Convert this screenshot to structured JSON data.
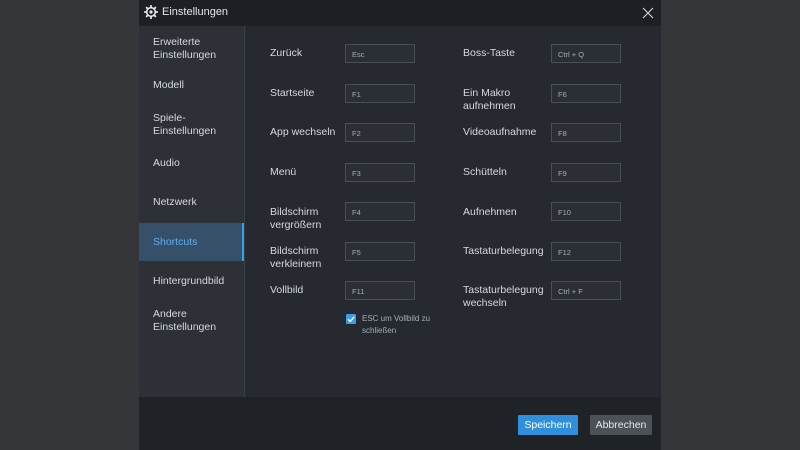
{
  "window": {
    "title": "Einstellungen",
    "icon": "gear-icon"
  },
  "sidebar": {
    "items": [
      {
        "label": "Erweiterte Einstellungen"
      },
      {
        "label": "Modell"
      },
      {
        "label": "Spiele-Einstellungen"
      },
      {
        "label": "Audio"
      },
      {
        "label": "Netzwerk"
      },
      {
        "label": "Shortcuts",
        "active": true
      },
      {
        "label": "Hintergrundbild"
      },
      {
        "label": "Andere Einstellungen"
      }
    ]
  },
  "shortcuts": {
    "left": [
      {
        "label": "Zurück",
        "key": "Esc"
      },
      {
        "label": "Startseite",
        "key": "F1"
      },
      {
        "label": "App wechseln",
        "key": "F2"
      },
      {
        "label": "Menü",
        "key": "F3"
      },
      {
        "label": "Bildschirm vergrößern",
        "key": "F4"
      },
      {
        "label": "Bildschirm verkleinern",
        "key": "F5"
      },
      {
        "label": "Vollbild",
        "key": "F11"
      }
    ],
    "right": [
      {
        "label": "Boss-Taste",
        "key": "Ctrl + Q"
      },
      {
        "label": "Ein Makro aufnehmen",
        "key": "F6"
      },
      {
        "label": "Videoaufnahme",
        "key": "F8"
      },
      {
        "label": "Schütteln",
        "key": "F9"
      },
      {
        "label": "Aufnehmen",
        "key": "F10"
      },
      {
        "label": "Tastaturbelegung",
        "key": "F12"
      },
      {
        "label": "Tastaturbelegung wechseln",
        "key": "Ctrl + F"
      }
    ],
    "esc_fullscreen": {
      "label": "ESC um Vollbild zu schließen",
      "checked": true
    }
  },
  "footer": {
    "save_label": "Speichern",
    "cancel_label": "Abbrechen"
  },
  "colors": {
    "accent": "#2f8fdc",
    "active_text": "#5aaff2"
  }
}
